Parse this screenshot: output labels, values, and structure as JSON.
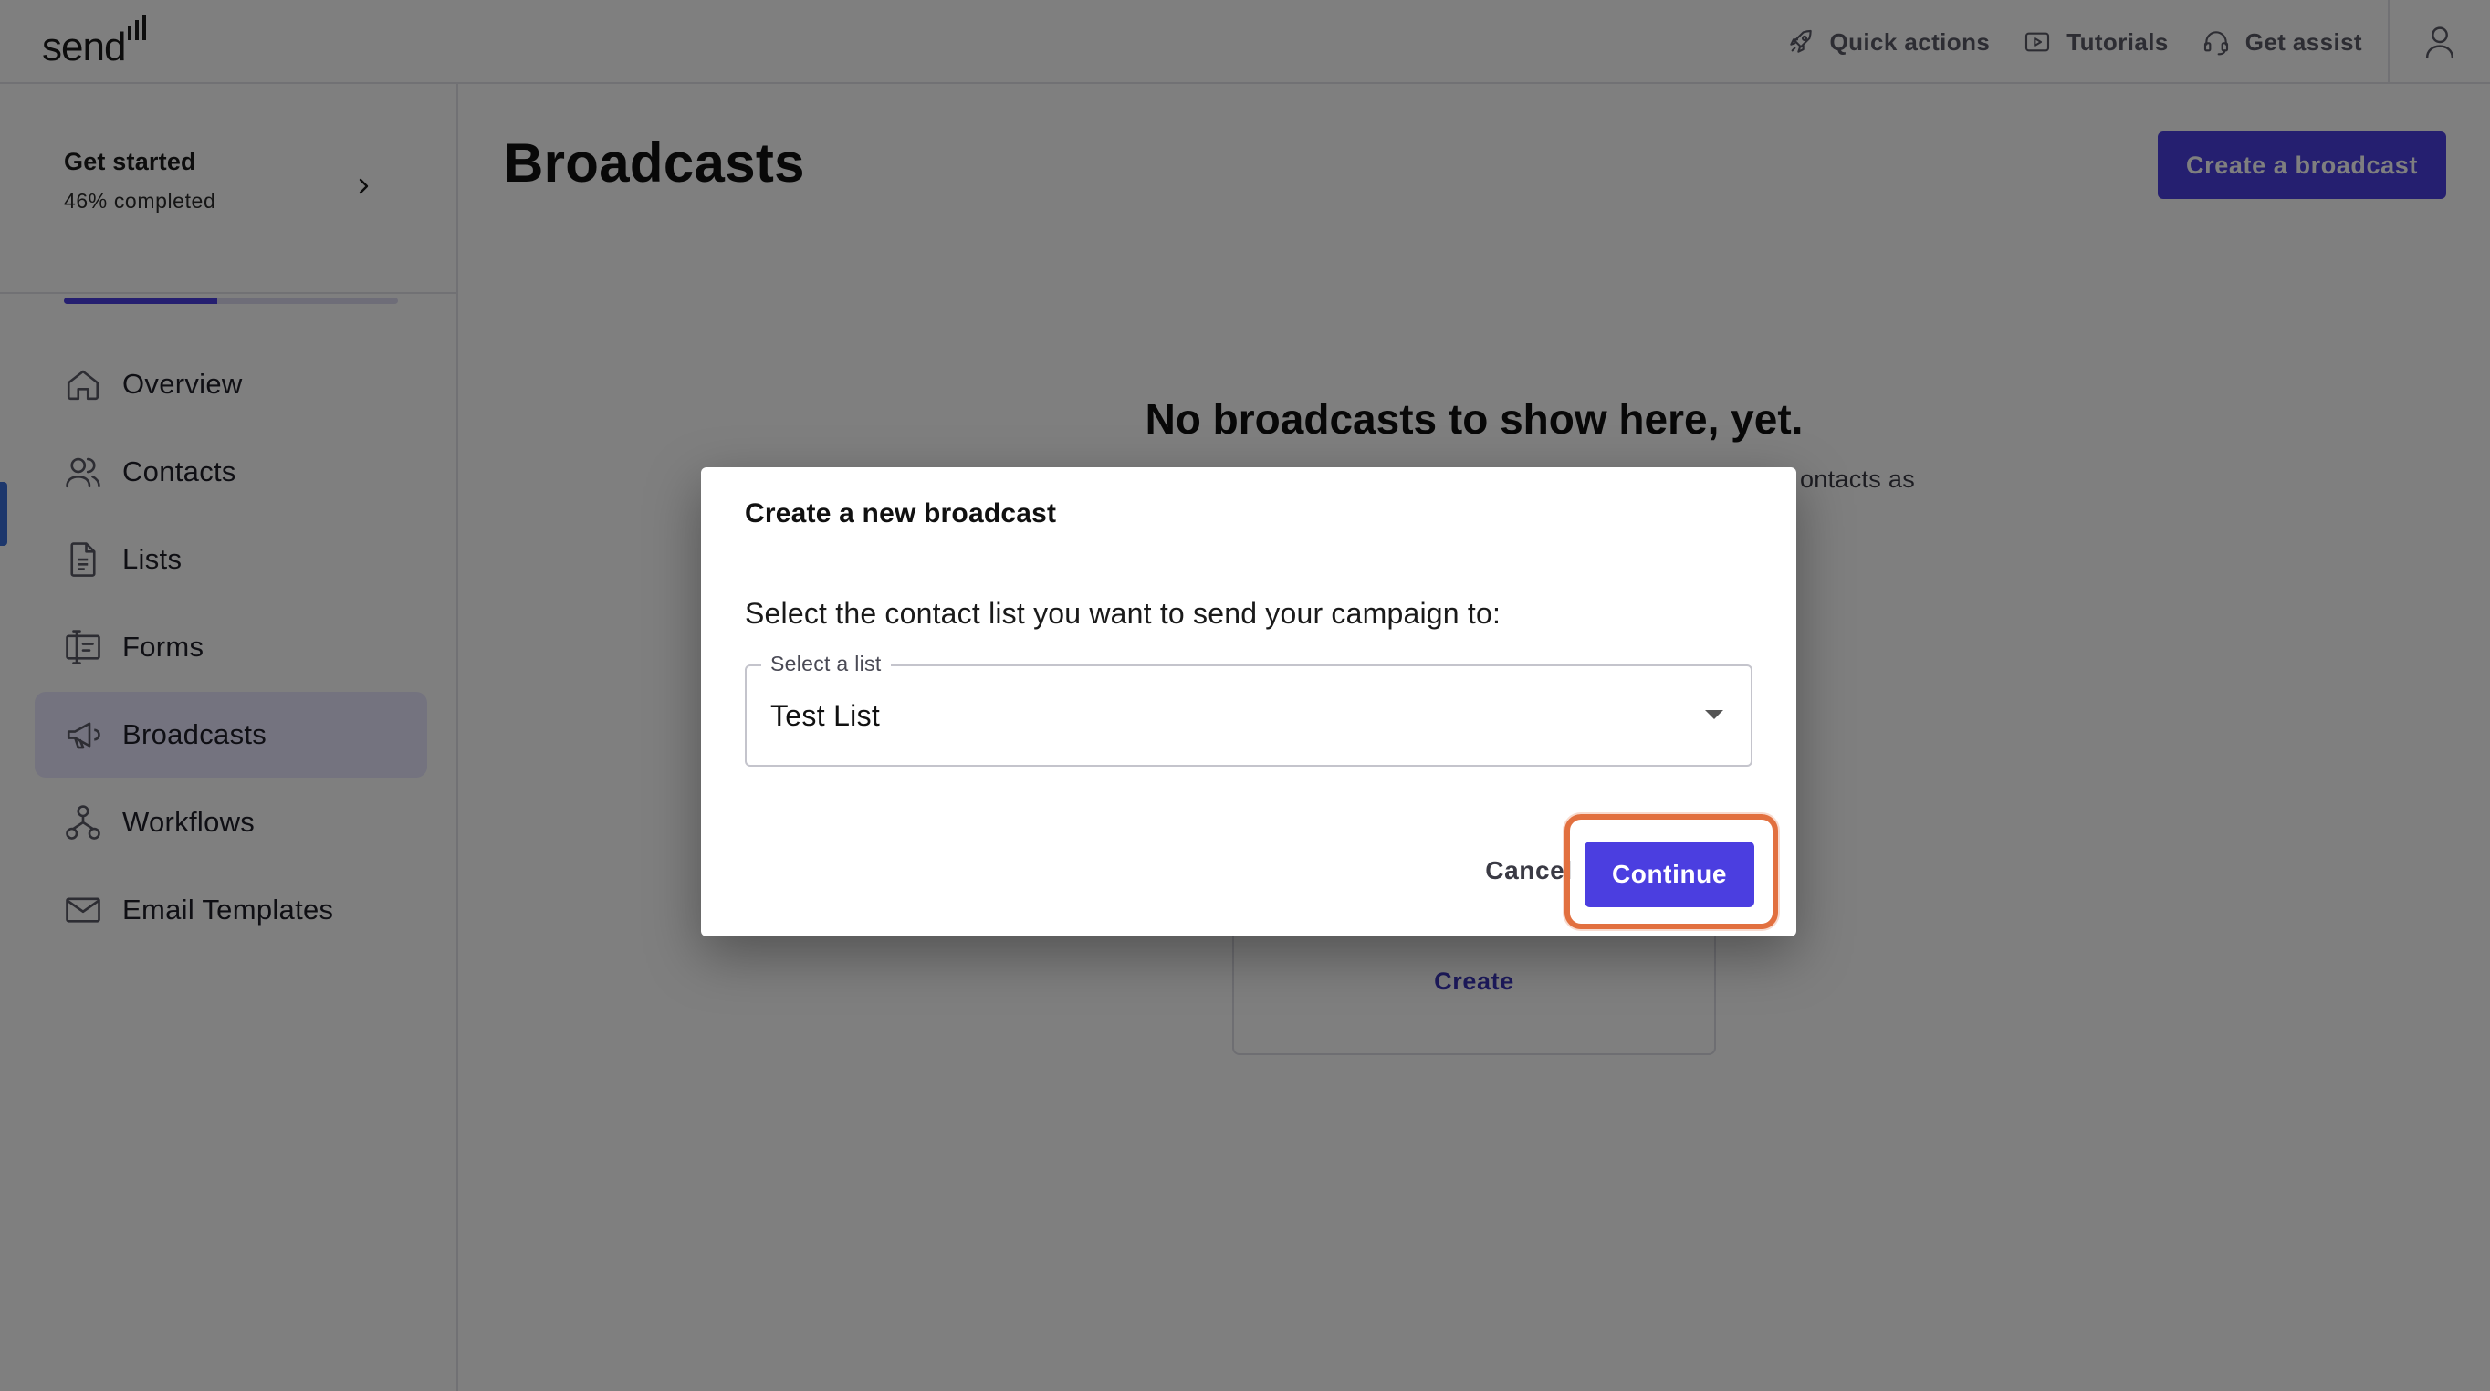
{
  "brand": {
    "name": "send",
    "accent": "#4b3ee0",
    "highlight": "#e2703f"
  },
  "topbar": {
    "actions": [
      {
        "label": "Quick actions",
        "icon": "rocket-icon"
      },
      {
        "label": "Tutorials",
        "icon": "play-icon"
      },
      {
        "label": "Get assist",
        "icon": "headset-icon"
      }
    ],
    "user_icon": "user-icon"
  },
  "sidebar": {
    "get_started": {
      "title": "Get started",
      "progress_text": "46% completed",
      "progress": 0.46
    },
    "items": [
      {
        "label": "Overview",
        "icon": "home-icon",
        "active": false
      },
      {
        "label": "Contacts",
        "icon": "contacts-icon",
        "active": false
      },
      {
        "label": "Lists",
        "icon": "list-document-icon",
        "active": false
      },
      {
        "label": "Forms",
        "icon": "form-icon",
        "active": false
      },
      {
        "label": "Broadcasts",
        "icon": "megaphone-icon",
        "active": true
      },
      {
        "label": "Workflows",
        "icon": "workflow-icon",
        "active": false
      },
      {
        "label": "Email Templates",
        "icon": "mail-icon",
        "active": false
      }
    ]
  },
  "main": {
    "title": "Broadcasts",
    "create_button": "Create a broadcast",
    "empty_title": "No broadcasts to show here, yet.",
    "empty_sub_visible": "ontacts as",
    "card_link": "Create"
  },
  "modal": {
    "title": "Create a new broadcast",
    "prompt": "Select the contact list you want to send your campaign to:",
    "select_label": "Select a list",
    "select_value": "Test List",
    "cancel": "Cancel",
    "continue": "Continue"
  }
}
